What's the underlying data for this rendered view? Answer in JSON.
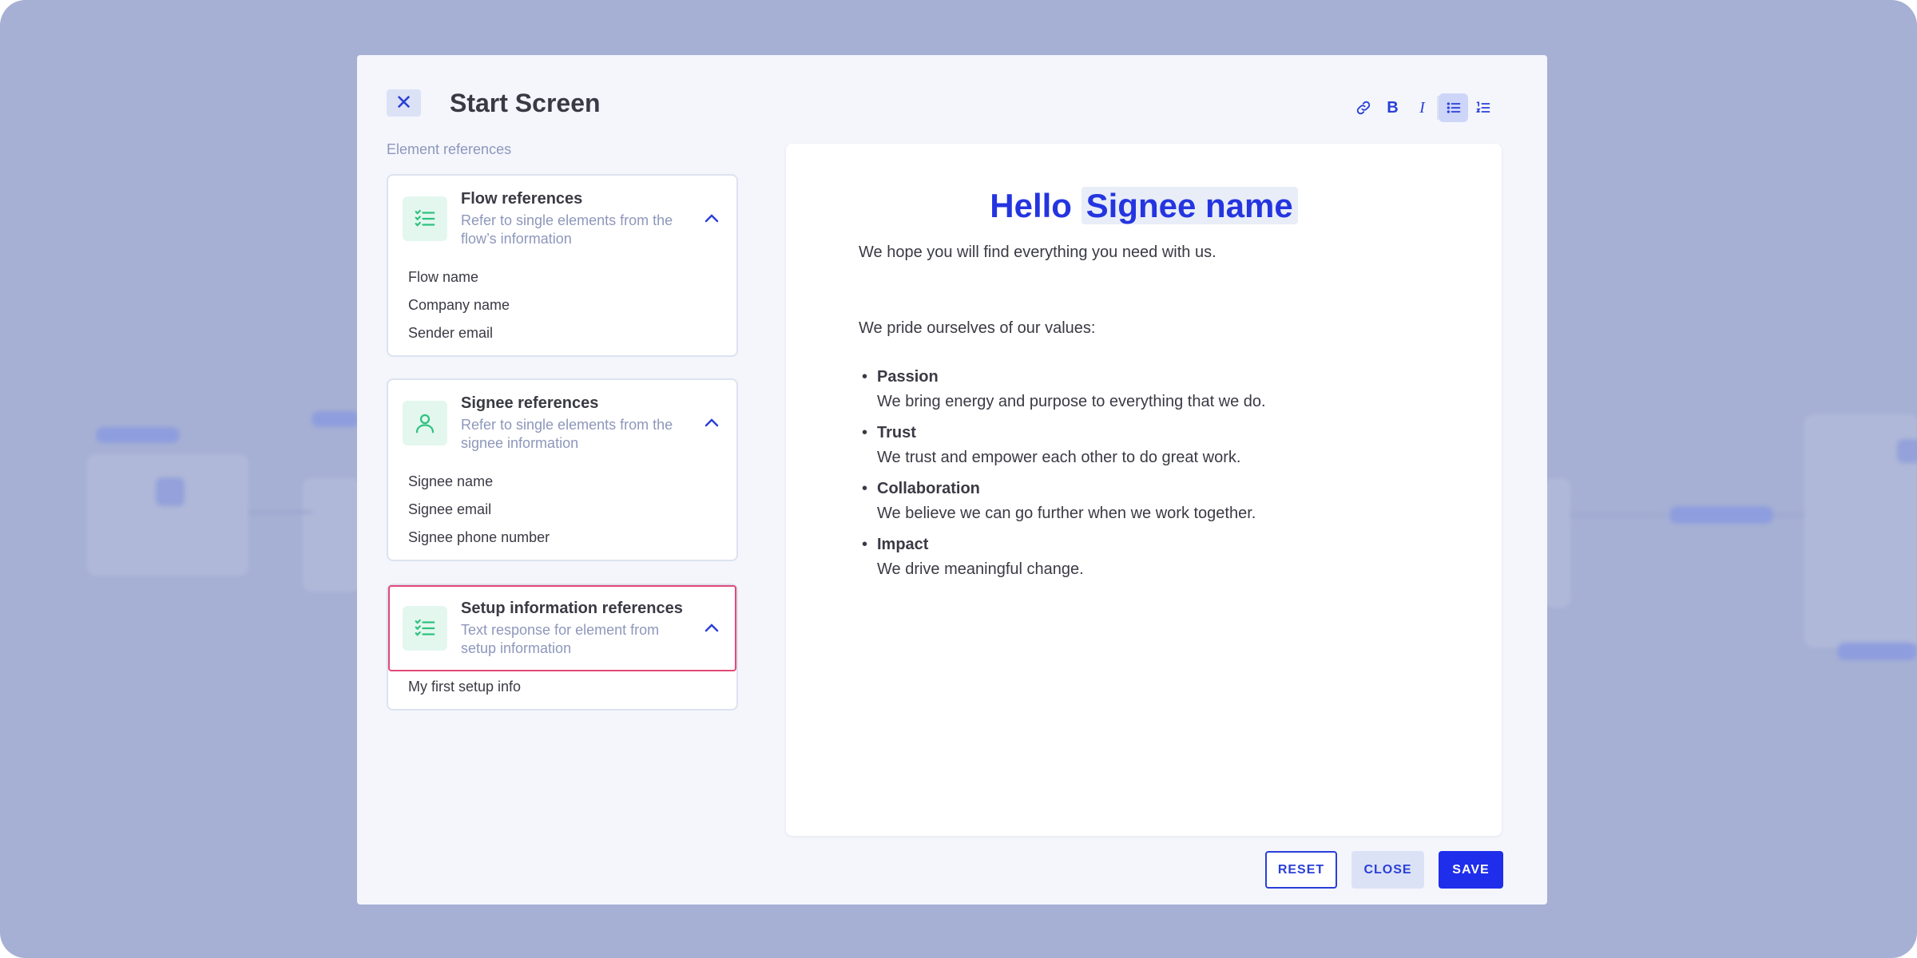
{
  "modal": {
    "title": "Start Screen",
    "section_label": "Element references"
  },
  "toolbar": {
    "items": [
      {
        "icon": "link-icon"
      },
      {
        "icon": "bold-icon",
        "glyph": "B"
      },
      {
        "icon": "italic-icon",
        "glyph": "I"
      },
      {
        "icon": "bullet-list-icon",
        "active": true
      },
      {
        "icon": "numbered-list-icon"
      }
    ]
  },
  "references": [
    {
      "title": "Flow references",
      "subtitle": "Refer to single elements from the flow’s information",
      "icon": "checklist-icon",
      "items": [
        "Flow name",
        "Company name",
        "Sender email"
      ]
    },
    {
      "title": "Signee references",
      "subtitle": "Refer to single elements from the signee information",
      "icon": "user-icon",
      "items": [
        "Signee name",
        "Signee email",
        "Signee phone number"
      ]
    },
    {
      "title": "Setup information references",
      "subtitle": "Text response for element from setup information",
      "icon": "checklist-icon",
      "items": [
        "My first setup info"
      ]
    }
  ],
  "editor": {
    "heading_prefix": "Hello",
    "heading_tag": "Signee name",
    "intro": "We hope you will find everything you need with us.",
    "values_intro": "We pride ourselves of our values:",
    "values": [
      {
        "title": "Passion",
        "desc": "We bring energy and purpose to everything that we do."
      },
      {
        "title": "Trust",
        "desc": "We trust and empower each other to do great work."
      },
      {
        "title": "Collaboration",
        "desc": "We believe we can go further when we work together."
      },
      {
        "title": "Impact",
        "desc": "We drive meaningful change."
      }
    ]
  },
  "footer": {
    "reset_label": "RESET",
    "close_label": "CLOSE",
    "save_label": "SAVE"
  },
  "colors": {
    "accent": "#1f2eea",
    "highlight_border": "#e24a79",
    "icon_green": "#2ec27e",
    "backdrop": "#a6b0d4"
  }
}
